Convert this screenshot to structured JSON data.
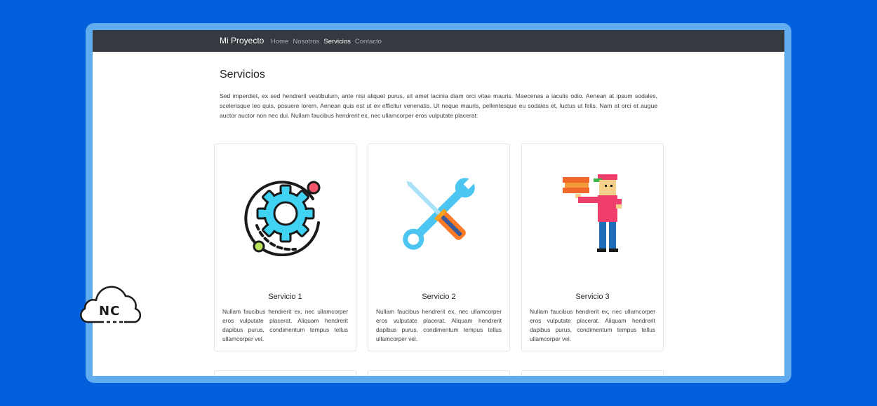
{
  "navbar": {
    "brand": "Mi Proyecto",
    "links": [
      {
        "label": "Home",
        "active": false
      },
      {
        "label": "Nosotros",
        "active": false
      },
      {
        "label": "Servicios",
        "active": true
      },
      {
        "label": "Contacto",
        "active": false
      }
    ]
  },
  "page": {
    "title": "Servicios",
    "intro": "Sed imperdiet, ex sed hendrerit vestibulum, ante nisi aliquet purus, sit amet lacinia diam orci vitae mauris. Maecenas a iaculis odio. Aenean at ipsum sodales, scelerisque leo quis, posuere lorem. Aenean quis est ut ex efficitur venenatis. Ut neque mauris, pellentesque eu sodales et, luctus ut felis. Nam at orci et augue auctor auctor non nec dui. Nullam faucibus hendrerit ex, nec ullamcorper eros vulputate placerat:"
  },
  "cards": [
    {
      "title": "Servicio 1",
      "text": "Nullam faucibus hendrerit ex, nec ullamcorper eros vulputate placerat. Aliquam hendrerit dapibus purus, condimentum tempus tellus ullamcorper vel.",
      "icon": "gear-orbit-icon"
    },
    {
      "title": "Servicio 2",
      "text": "Nullam faucibus hendrerit ex, nec ullamcorper eros vulputate placerat. Aliquam hendrerit dapibus purus, condimentum tempus tellus ullamcorper vel.",
      "icon": "wrench-screwdriver-icon"
    },
    {
      "title": "Servicio 3",
      "text": "Nullam faucibus hendrerit ex, nec ullamcorper eros vulputate placerat. Aliquam hendrerit dapibus purus, condimentum tempus tellus ullamcorper vel.",
      "icon": "delivery-person-icon"
    }
  ],
  "watermark": {
    "text": "NC",
    "icon": "cloud-logo-icon"
  },
  "colors": {
    "background": "#0260dc",
    "frame": "#61abef",
    "navbar": "#343a40",
    "gear": "#3fd2f2",
    "wrench": "#4cc6f1",
    "screwdriver_handle": "#ff7a26",
    "person_shirt": "#ef3e6b"
  }
}
